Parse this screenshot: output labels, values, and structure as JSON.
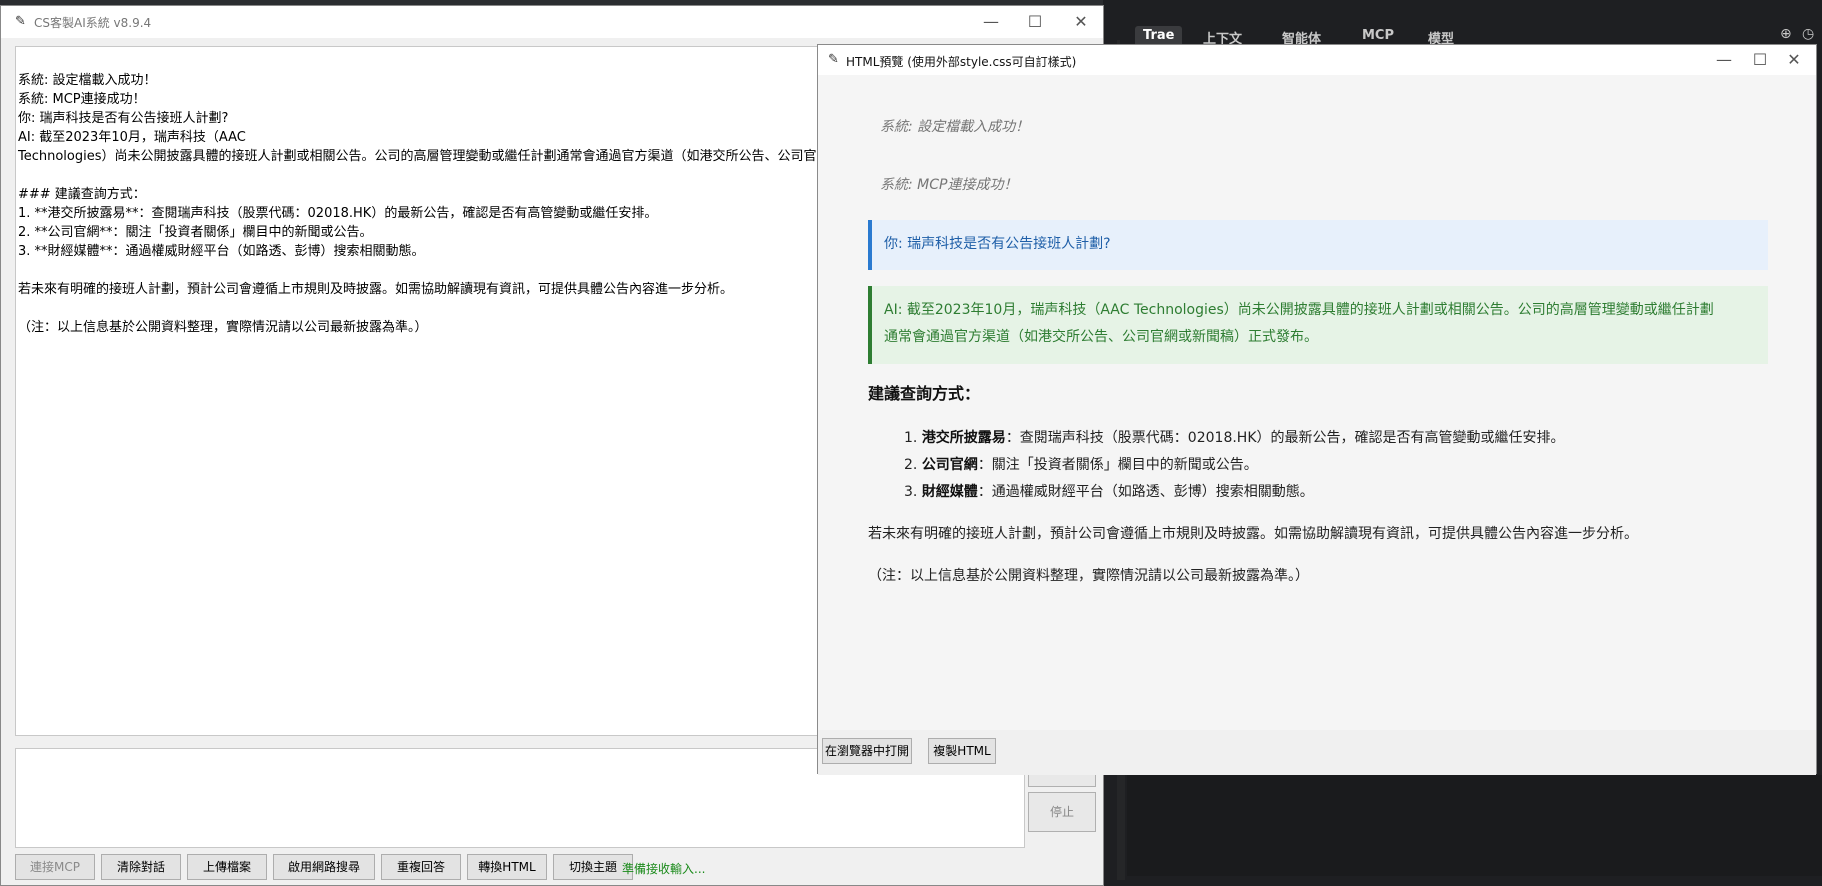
{
  "main_window": {
    "title": "CS客製AI系統 v8.9.4",
    "chat_lines": [
      "系統: 設定檔載入成功！",
      "系統: MCP連接成功！",
      "你: 瑞声科技是否有公告接班人計劃?",
      "AI: 截至2023年10月，瑞声科技（AAC",
      "Technologies）尚未公開披露具體的接班人計劃或相關公告。公司的高層管理變動或繼任計劃通常會通過官方渠道（如港交所公告、公司官網",
      "",
      "### 建議查詢方式：",
      "1. **港交所披露易**：查閱瑞声科技（股票代碼：02018.HK）的最新公告，確認是否有高管變動或繼任安排。",
      "2. **公司官網**：關注「投資者關係」欄目中的新聞或公告。",
      "3. **財經媒體**：通過權威財經平台（如路透、彭博）搜索相關動態。",
      "",
      "若未來有明確的接班人計劃，預計公司會遵循上市規則及時披露。如需協助解讀現有資訊，可提供具體公告內容進一步分析。",
      "",
      "（注：以上信息基於公開資料整理，實際情況請以公司最新披露為準。）"
    ],
    "stop_label": "停止",
    "toolbar": {
      "connect_mcp": "連接MCP",
      "clear_chat": "清除對話",
      "upload_file": "上傳檔案",
      "web_search": "啟用網路搜尋",
      "regenerate": "重複回答",
      "convert_html": "轉換HTML",
      "switch_theme": "切換主題"
    },
    "status": "準備接收輸入..."
  },
  "preview_window": {
    "title": "HTML預覽 (使用外部style.css可自訂樣式)",
    "system_msg_1": "系統: 設定檔載入成功！",
    "system_msg_2": "系統: MCP連接成功！",
    "user_msg": "你: 瑞声科技是否有公告接班人計劃?",
    "ai_msg_line1": "AI: 截至2023年10月，瑞声科技（AAC Technologies）尚未公開披露具體的接班人計劃或相關公告。公司的高層管理變動或繼任計劃",
    "ai_msg_line2": "通常會通過官方渠道（如港交所公告、公司官網或新聞稿）正式發布。",
    "heading": "建議查詢方式：",
    "list": [
      {
        "num": "1.",
        "bold": "港交所披露易",
        "text": "：查閱瑞声科技（股票代碼：02018.HK）的最新公告，確認是否有高管變動或繼任安排。"
      },
      {
        "num": "2.",
        "bold": "公司官網",
        "text": "：關注「投資者關係」欄目中的新聞或公告。"
      },
      {
        "num": "3.",
        "bold": "財經媒體",
        "text": "：通過權威財經平台（如路透、彭博）搜索相關動態。"
      }
    ],
    "paragraph": "若未來有明確的接班人計劃，預計公司會遵循上市規則及時披露。如需協助解讀現有資訊，可提供具體公告內容進一步分析。",
    "note": "（注：以上信息基於公開資料整理，實際情況請以公司最新披露為準。）",
    "open_in_browser": "在瀏覽器中打開",
    "copy_html": "複製HTML"
  },
  "ide": {
    "tabs": [
      "Trae",
      "上下文",
      "智能体",
      "MCP",
      "模型"
    ]
  },
  "colors": {
    "status_green": "#1a8a1a",
    "user_accent": "#2a7ad0",
    "ai_accent": "#2e7d32"
  }
}
